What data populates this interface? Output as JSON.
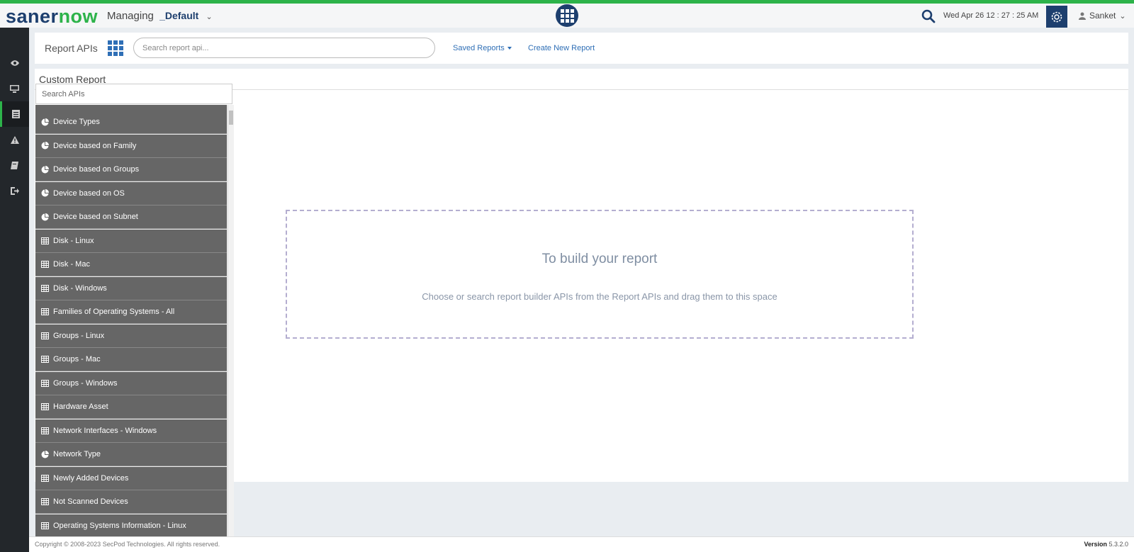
{
  "header": {
    "logo_a": "saner",
    "logo_b": "now",
    "managing_label": "Managing",
    "account": "_Default",
    "datetime": "Wed Apr 26  12 : 27 : 25 AM",
    "user": "Sanket",
    "accent_green": "#2db34a",
    "brand_navy": "#1d3f6e"
  },
  "sidebar": {
    "items": [
      {
        "name": "eye-icon"
      },
      {
        "name": "monitor-icon"
      },
      {
        "name": "report-icon",
        "active": true
      },
      {
        "name": "alert-icon"
      },
      {
        "name": "book-icon"
      },
      {
        "name": "logout-icon"
      }
    ]
  },
  "apibar": {
    "title": "Report APIs",
    "search_placeholder": "Search report api...",
    "saved_reports": "Saved Reports",
    "create_new": "Create New Report"
  },
  "main": {
    "title": "Custom Report",
    "dropzone_heading": "To build your report",
    "dropzone_text": "Choose or search report builder APIs from the Report APIs and drag them to this space"
  },
  "api_list": {
    "search_placeholder": "Search APIs",
    "items": [
      {
        "label": "Device Types",
        "icon": "pie-icon"
      },
      {
        "label": "Device based on Family",
        "icon": "pie-icon"
      },
      {
        "label": "Device based on Groups",
        "icon": "pie-icon"
      },
      {
        "label": "Device based on OS",
        "icon": "pie-icon"
      },
      {
        "label": "Device based on Subnet",
        "icon": "pie-icon"
      },
      {
        "label": "Disk - Linux",
        "icon": "table-icon"
      },
      {
        "label": "Disk - Mac",
        "icon": "table-icon"
      },
      {
        "label": "Disk - Windows",
        "icon": "table-icon"
      },
      {
        "label": "Families of Operating Systems - All",
        "icon": "table-icon"
      },
      {
        "label": "Groups - Linux",
        "icon": "table-icon"
      },
      {
        "label": "Groups - Mac",
        "icon": "table-icon"
      },
      {
        "label": "Groups - Windows",
        "icon": "table-icon"
      },
      {
        "label": "Hardware Asset",
        "icon": "table-icon"
      },
      {
        "label": "Network Interfaces - Windows",
        "icon": "table-icon"
      },
      {
        "label": "Network Type",
        "icon": "pie-icon"
      },
      {
        "label": "Newly Added Devices",
        "icon": "table-icon"
      },
      {
        "label": "Not Scanned Devices",
        "icon": "table-icon"
      },
      {
        "label": "Operating Systems Information - Linux",
        "icon": "table-icon"
      }
    ]
  },
  "footer": {
    "copyright": "Copyright © 2008-2023 SecPod Technologies. All rights reserved.",
    "version_label": "Version",
    "version": "5.3.2.0"
  }
}
